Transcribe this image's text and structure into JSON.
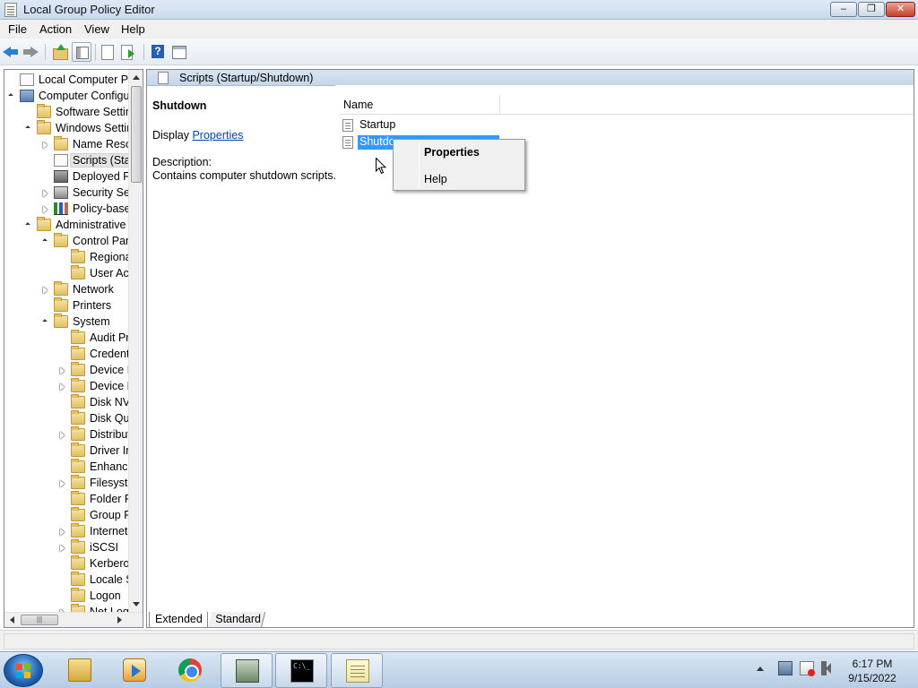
{
  "window": {
    "title": "Local Group Policy Editor",
    "minimize": "–",
    "maximize": "❐",
    "close": "✕"
  },
  "menu": [
    "File",
    "Action",
    "View",
    "Help"
  ],
  "toolbar": {
    "icons": [
      "back-arrow-icon",
      "forward-arrow-icon",
      "up-folder-icon",
      "show-hide-tree-icon",
      "properties-sheet-icon",
      "export-list-icon",
      "help-icon",
      "properties-icon"
    ]
  },
  "tree": {
    "items": [
      {
        "label": "Local Computer Policy",
        "level": 0,
        "icon": "policy-icon",
        "state": "none"
      },
      {
        "label": "Computer Configu",
        "level": 0,
        "icon": "computer-icon",
        "state": "expanded"
      },
      {
        "label": "Software Setting",
        "level": 1,
        "icon": "folder-icon",
        "state": "none"
      },
      {
        "label": "Windows Settin",
        "level": 1,
        "icon": "folder-icon",
        "state": "expanded"
      },
      {
        "label": "Name Resol",
        "level": 2,
        "icon": "folder-icon",
        "state": "collapsed"
      },
      {
        "label": "Scripts (Star",
        "level": 2,
        "icon": "script-icon",
        "state": "none",
        "selected": true
      },
      {
        "label": "Deployed Pr",
        "level": 2,
        "icon": "printer-icon",
        "state": "none"
      },
      {
        "label": "Security Sett",
        "level": 2,
        "icon": "security-icon",
        "state": "collapsed"
      },
      {
        "label": "Policy-base",
        "level": 2,
        "icon": "chart-icon",
        "state": "collapsed"
      },
      {
        "label": "Administrative T",
        "level": 1,
        "icon": "folder-icon",
        "state": "expanded"
      },
      {
        "label": "Control Pan",
        "level": 2,
        "icon": "folder-icon",
        "state": "expanded"
      },
      {
        "label": "Regiona",
        "level": 3,
        "icon": "folder-icon",
        "state": "none"
      },
      {
        "label": "User Acc",
        "level": 3,
        "icon": "folder-icon",
        "state": "none"
      },
      {
        "label": "Network",
        "level": 2,
        "icon": "folder-icon",
        "state": "collapsed"
      },
      {
        "label": "Printers",
        "level": 2,
        "icon": "folder-icon",
        "state": "none"
      },
      {
        "label": "System",
        "level": 2,
        "icon": "folder-icon",
        "state": "expanded"
      },
      {
        "label": "Audit Pr",
        "level": 3,
        "icon": "folder-icon",
        "state": "none"
      },
      {
        "label": "Credenti",
        "level": 3,
        "icon": "folder-icon",
        "state": "none"
      },
      {
        "label": "Device Ir",
        "level": 3,
        "icon": "folder-icon",
        "state": "collapsed"
      },
      {
        "label": "Device R",
        "level": 3,
        "icon": "folder-icon",
        "state": "collapsed"
      },
      {
        "label": "Disk NV",
        "level": 3,
        "icon": "folder-icon",
        "state": "none"
      },
      {
        "label": "Disk Quo",
        "level": 3,
        "icon": "folder-icon",
        "state": "none"
      },
      {
        "label": "Distribut",
        "level": 3,
        "icon": "folder-icon",
        "state": "collapsed"
      },
      {
        "label": "Driver In",
        "level": 3,
        "icon": "folder-icon",
        "state": "none"
      },
      {
        "label": "Enhance",
        "level": 3,
        "icon": "folder-icon",
        "state": "none"
      },
      {
        "label": "Filesyste",
        "level": 3,
        "icon": "folder-icon",
        "state": "collapsed"
      },
      {
        "label": "Folder R",
        "level": 3,
        "icon": "folder-icon",
        "state": "none"
      },
      {
        "label": "Group P",
        "level": 3,
        "icon": "folder-icon",
        "state": "none"
      },
      {
        "label": "Internet",
        "level": 3,
        "icon": "folder-icon",
        "state": "collapsed"
      },
      {
        "label": "iSCSI",
        "level": 3,
        "icon": "folder-icon",
        "state": "collapsed"
      },
      {
        "label": "Kerberos",
        "level": 3,
        "icon": "folder-icon",
        "state": "none"
      },
      {
        "label": "Locale S",
        "level": 3,
        "icon": "folder-icon",
        "state": "none"
      },
      {
        "label": "Logon",
        "level": 3,
        "icon": "folder-icon",
        "state": "none"
      },
      {
        "label": "Net Log",
        "level": 3,
        "icon": "folder-icon",
        "state": "collapsed"
      }
    ],
    "hscroll_thumb": "|||"
  },
  "details": {
    "header": "Scripts (Startup/Shutdown)",
    "item_title": "Shutdown",
    "display_prefix": "Display ",
    "display_link": "Properties",
    "description_label": "Description:",
    "description_text": "Contains computer shutdown scripts.",
    "column_name": "Name",
    "rows": [
      {
        "label": "Startup",
        "selected": false
      },
      {
        "label": "Shutdown",
        "selected": true
      }
    ],
    "tabs": [
      "Extended",
      "Standard"
    ]
  },
  "context_menu": {
    "items": [
      {
        "label": "Properties",
        "bold": true
      },
      {
        "label": "Help",
        "bold": false
      }
    ]
  },
  "taskbar": {
    "apps": [
      "windows-explorer-icon",
      "media-player-icon",
      "chrome-icon",
      "group-policy-icon",
      "command-prompt-icon",
      "notepad-icon"
    ],
    "cmd_glyph": "C:\\_",
    "time": "6:17 PM",
    "date": "9/15/2022"
  }
}
